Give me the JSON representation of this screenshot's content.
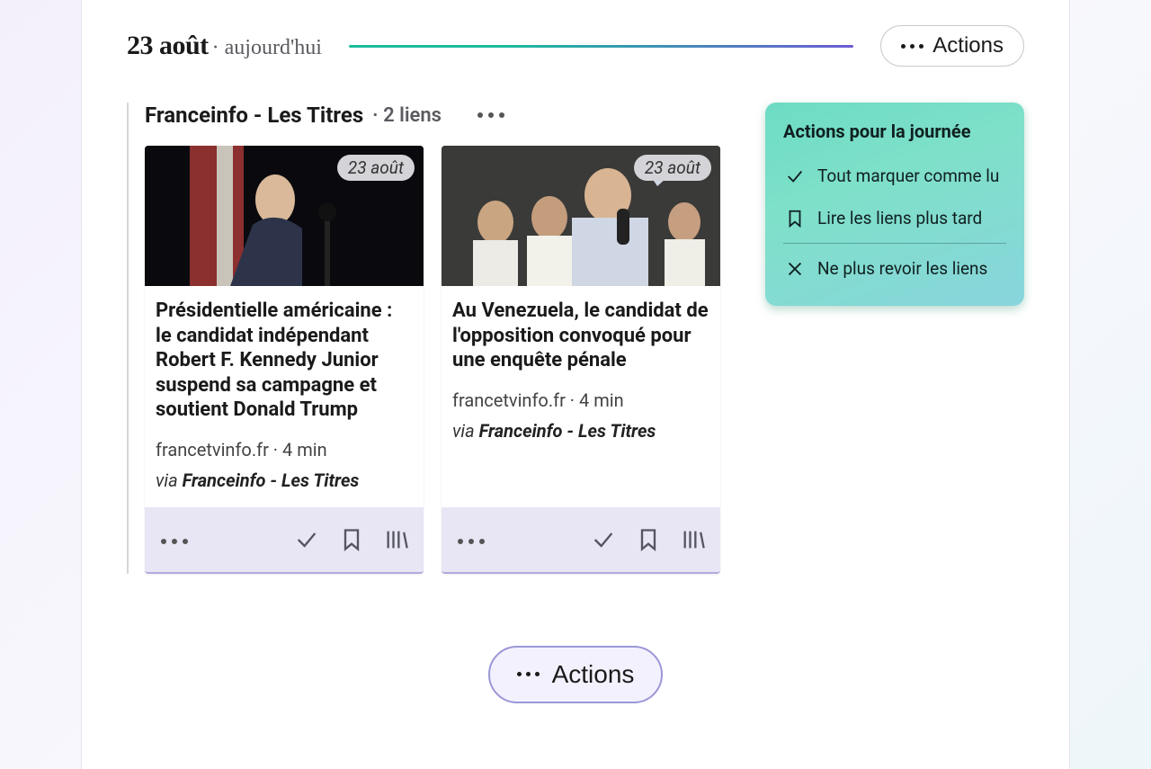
{
  "header": {
    "date": "23 août",
    "sub": "· aujourd'hui",
    "actions_label": "Actions"
  },
  "feed": {
    "title": "Franceinfo - Les Titres",
    "count_label": "· 2 liens"
  },
  "cards": [
    {
      "badge": "23 août",
      "title": "Présidentielle américaine : le candidat indépendant Robert F. Kennedy Junior suspend sa campagne et soutient Donald Trump",
      "meta": "francetvinfo.fr · 4 min",
      "via_label": "via ",
      "via_source": "Franceinfo - Les Titres"
    },
    {
      "badge": "23 août",
      "title": "Au Venezuela, le candidat de l'opposition convoqué pour une enquête pénale",
      "meta": "francetvinfo.fr · 4 min",
      "via_label": "via ",
      "via_source": "Franceinfo - Les Titres"
    }
  ],
  "panel": {
    "title": "Actions pour la journée",
    "mark_read": "Tout marquer comme lu",
    "read_later": "Lire les liens plus tard",
    "dismiss": "Ne plus revoir les liens"
  },
  "bottom_actions_label": "Actions"
}
